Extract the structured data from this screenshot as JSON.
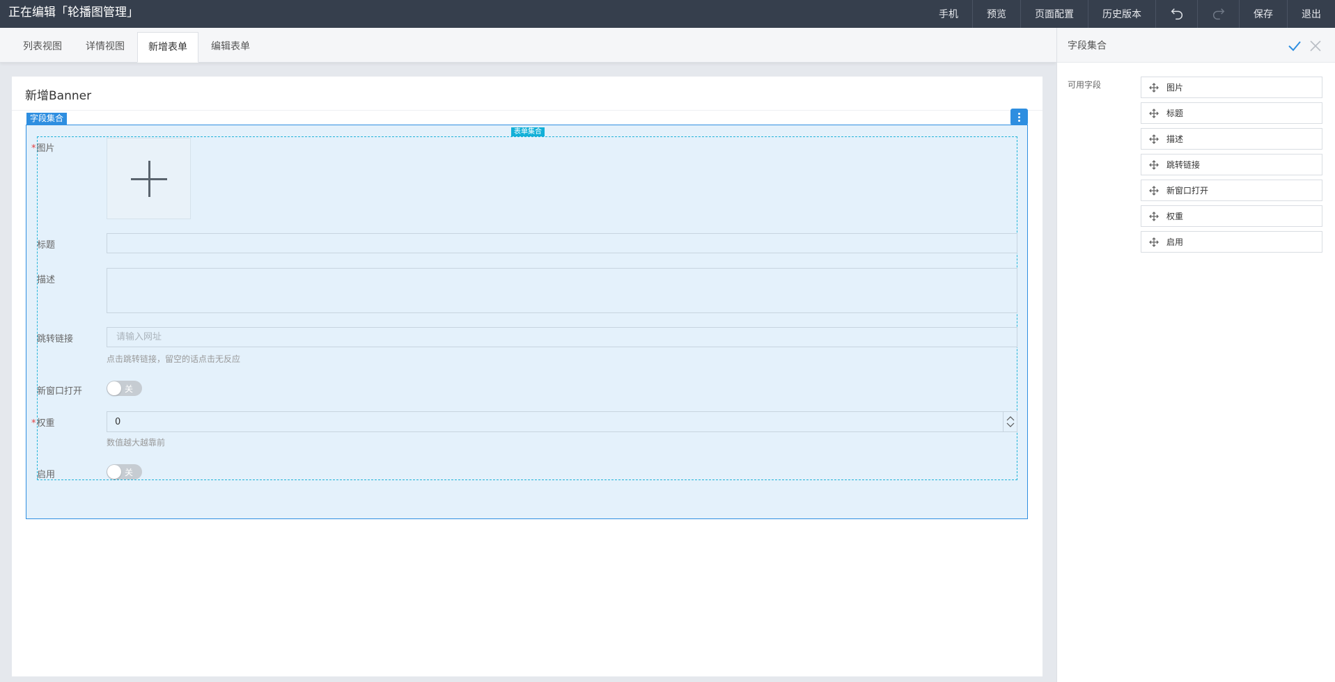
{
  "topbar": {
    "title": "正在编辑「轮播图管理」",
    "actions": {
      "mobile": "手机",
      "preview": "预览",
      "page_config": "页面配置",
      "history": "历史版本",
      "undo_icon": "undo-icon",
      "redo_icon": "redo-icon",
      "save": "保存",
      "exit": "退出"
    }
  },
  "tabs": [
    {
      "label": "列表视图",
      "active": false
    },
    {
      "label": "详情视图",
      "active": false
    },
    {
      "label": "新增表单",
      "active": true
    },
    {
      "label": "编辑表单",
      "active": false
    }
  ],
  "card": {
    "title": "新增Banner",
    "fieldset_label": "字段集合",
    "form_label": "表单集合"
  },
  "form": {
    "image_label": "图片",
    "title_label": "标题",
    "desc_label": "描述",
    "link_label": "跳转链接",
    "link_placeholder": "请输入网址",
    "link_hint": "点击跳转链接，留空的话点击无反应",
    "new_window_label": "新窗口打开",
    "new_window_state": "关",
    "weight_label": "权重",
    "weight_value": "0",
    "weight_hint": "数值越大越靠前",
    "enabled_label": "启用",
    "enabled_state": "关"
  },
  "panel": {
    "title": "字段集合",
    "available_label": "可用字段",
    "fields": [
      "图片",
      "标题",
      "描述",
      "跳转链接",
      "新窗口打开",
      "权重",
      "启用"
    ]
  },
  "colors": {
    "topbar": "#363f4d",
    "accent": "#2e8ee0",
    "form_tag": "#13b0d8",
    "fieldset_bg": "#e4f1fb"
  }
}
